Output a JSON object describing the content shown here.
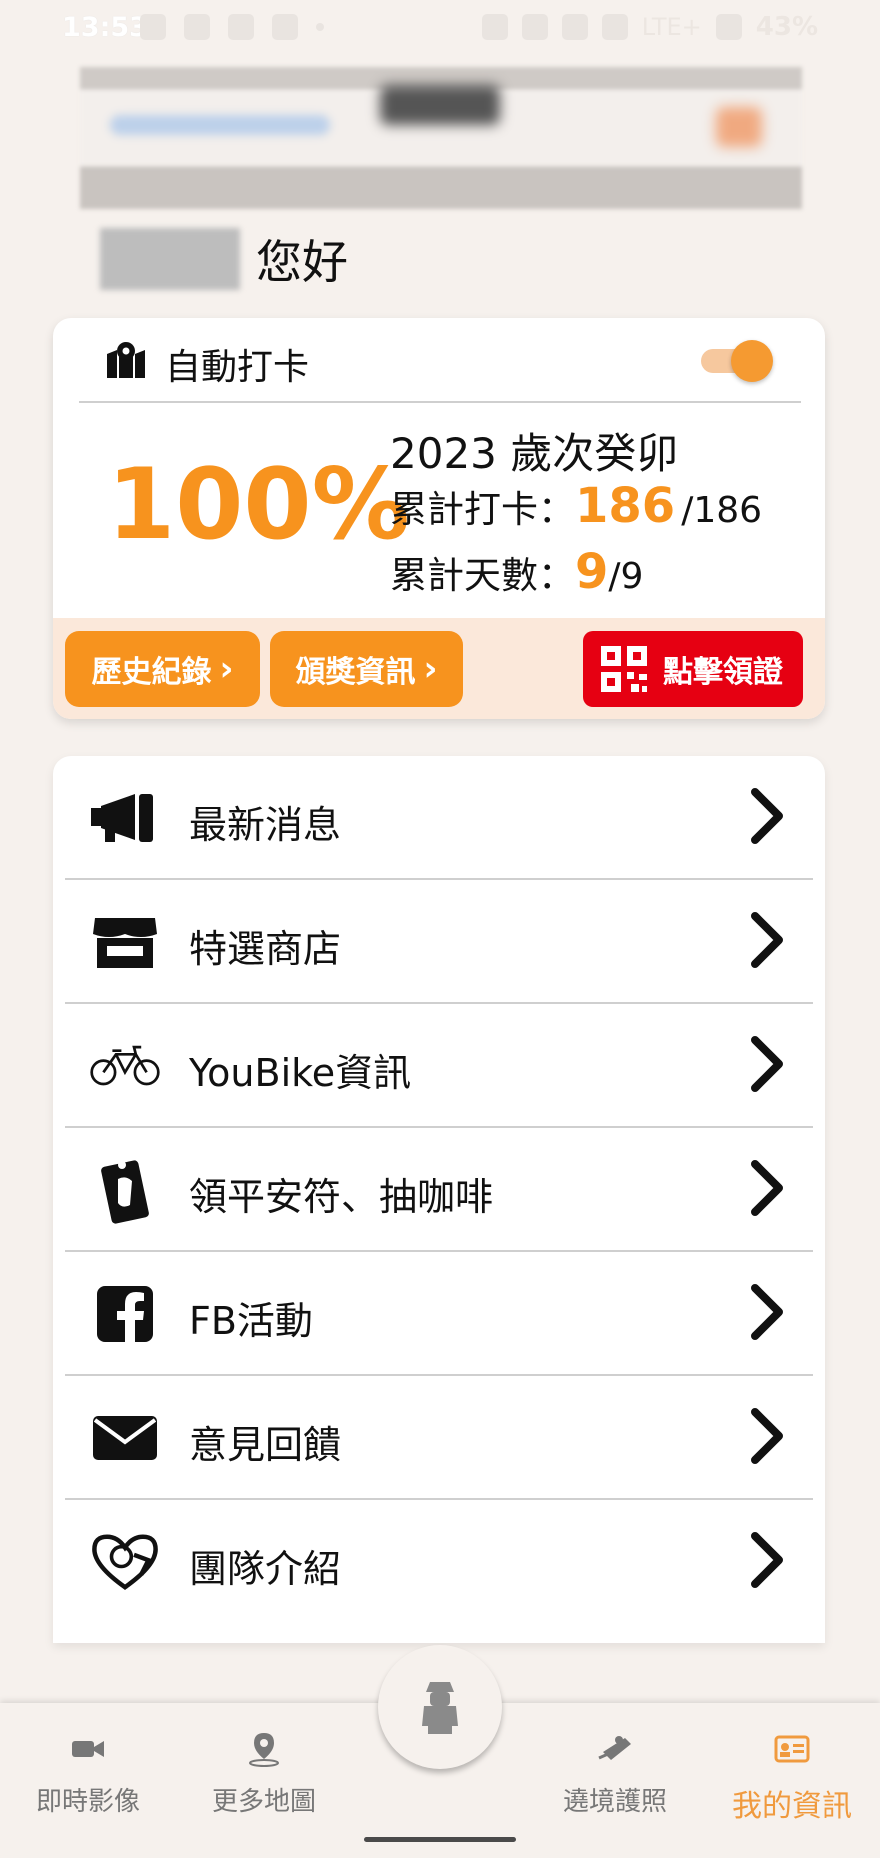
{
  "status_bar": {
    "time": "13:53",
    "network": "LTE+",
    "battery": "43%"
  },
  "greeting": {
    "suffix": "您好"
  },
  "checkin": {
    "title": "自動打卡",
    "auto_enabled": true,
    "percent": "100%",
    "year_label": "2023 歲次癸卯",
    "checkin_label": "累計打卡：",
    "checkin_value": "186",
    "checkin_total": "/186",
    "days_label": "累計天數：",
    "days_value": "9",
    "days_total": "/9",
    "history_button": "歷史紀錄",
    "award_button": "頒獎資訊",
    "certificate_button": "點擊領證"
  },
  "menu": [
    {
      "label": "最新消息",
      "icon": "megaphone-icon"
    },
    {
      "label": "特選商店",
      "icon": "store-icon"
    },
    {
      "label": "YouBike資訊",
      "icon": "bicycle-icon"
    },
    {
      "label": "領平安符、抽咖啡",
      "icon": "amulet-icon"
    },
    {
      "label": "FB活動",
      "icon": "facebook-icon"
    },
    {
      "label": "意見回饋",
      "icon": "envelope-icon"
    },
    {
      "label": "團隊介紹",
      "icon": "team-heart-icon"
    }
  ],
  "tabs": [
    {
      "label": "即時影像",
      "icon": "camera-icon"
    },
    {
      "label": "更多地圖",
      "icon": "map-pin-icon"
    },
    {
      "label": "遶境護照",
      "icon": "passport-icon"
    },
    {
      "label": "我的資訊",
      "icon": "id-card-icon",
      "active": true
    }
  ],
  "colors": {
    "accent": "#f7931e",
    "certificate": "#e60012",
    "background": "#f6f1ed"
  }
}
